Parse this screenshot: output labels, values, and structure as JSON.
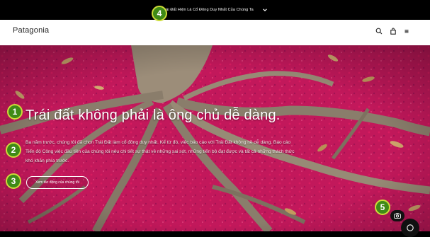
{
  "promo_bar": {
    "text": "Trái Đất Hiện Là Cổ Đông Duy Nhất Của Chúng Ta",
    "chevron_icon": "chevron-down-icon"
  },
  "header": {
    "logo": "Patagonia",
    "icons": [
      "search-icon",
      "shopping-bag-icon",
      "menu-icon"
    ]
  },
  "hero": {
    "title": "Trái đất không phải là ông chủ dễ dàng.",
    "body": "Ba năm trước, chúng tôi đã chọn Trái Đất làm cổ đông duy nhất. Kể từ đó, việc báo cáo với Trái Đất không hề dễ dàng. Báo cáo Tiến độ Công việc đầu tiên của chúng tôi nêu chi tiết sự thật về những sai sót, những tiến bộ đạt được và tất cả những thách thức khó khăn phía trước.",
    "cta_label": "Xem tác động của chúng tôi",
    "background_colors": {
      "flowers": "#c2185b",
      "roots": "#8a7d6b"
    }
  },
  "annotations": {
    "markers": [
      "1",
      "2",
      "3",
      "4",
      "5"
    ],
    "color": "#3f8a17",
    "ring": "#cddc39"
  },
  "floating": {
    "camera_icon": "camera-icon",
    "chat_icon": "chat-icon"
  }
}
